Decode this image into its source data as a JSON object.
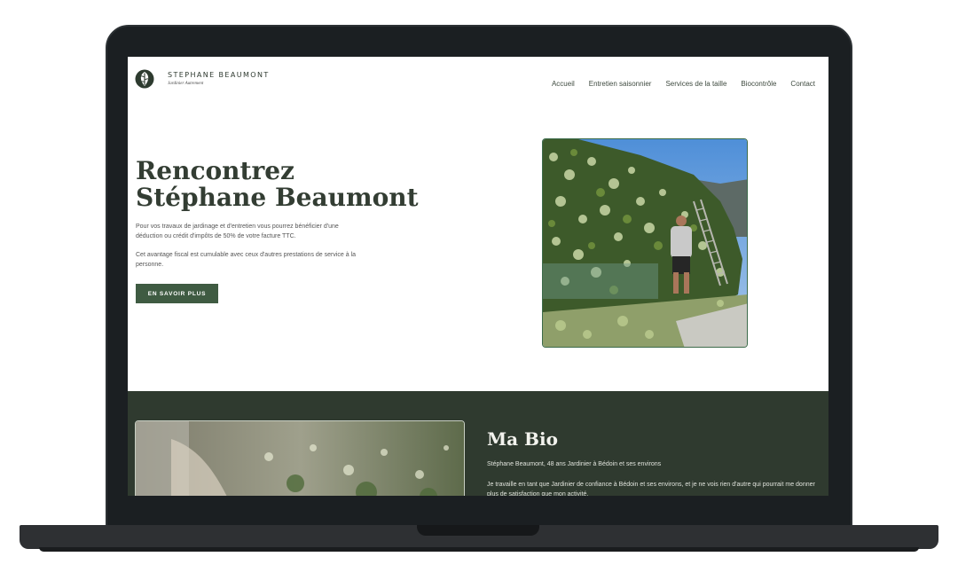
{
  "brand": {
    "name": "STEPHANE BEAUMONT",
    "tagline": "Jardinier Autrement"
  },
  "nav": {
    "items": [
      {
        "label": "Accueil"
      },
      {
        "label": "Entretien saisonnier"
      },
      {
        "label": "Services de la taille"
      },
      {
        "label": "Biocontrôle"
      },
      {
        "label": "Contact"
      }
    ]
  },
  "hero": {
    "title_line1": "Rencontrez",
    "title_line2": "Stéphane Beaumont",
    "paragraph1": "Pour vos travaux de jardinage et d'entretien vous pourrez bénéficier d'une déduction ou crédit d'impôts de 50% de votre facture TTC.",
    "paragraph2": "Cet avantage fiscal est cumulable avec ceux d'autres prestations de service à la personne.",
    "cta_label": "EN SAVOIR PLUS"
  },
  "bio": {
    "title": "Ma Bio",
    "subtitle": "Stéphane Beaumont, 48 ans Jardinier à Bédoin et ses environs",
    "text": "Je travaille en tant que Jardinier de confiance à Bédoin et ses environs, et je ne vois rien d'autre qui pourrait me donner plus de satisfaction que mon activité."
  },
  "colors": {
    "accent": "#3f5b42",
    "dark_section": "#2f3a2f",
    "frame": "#1b1f22"
  }
}
